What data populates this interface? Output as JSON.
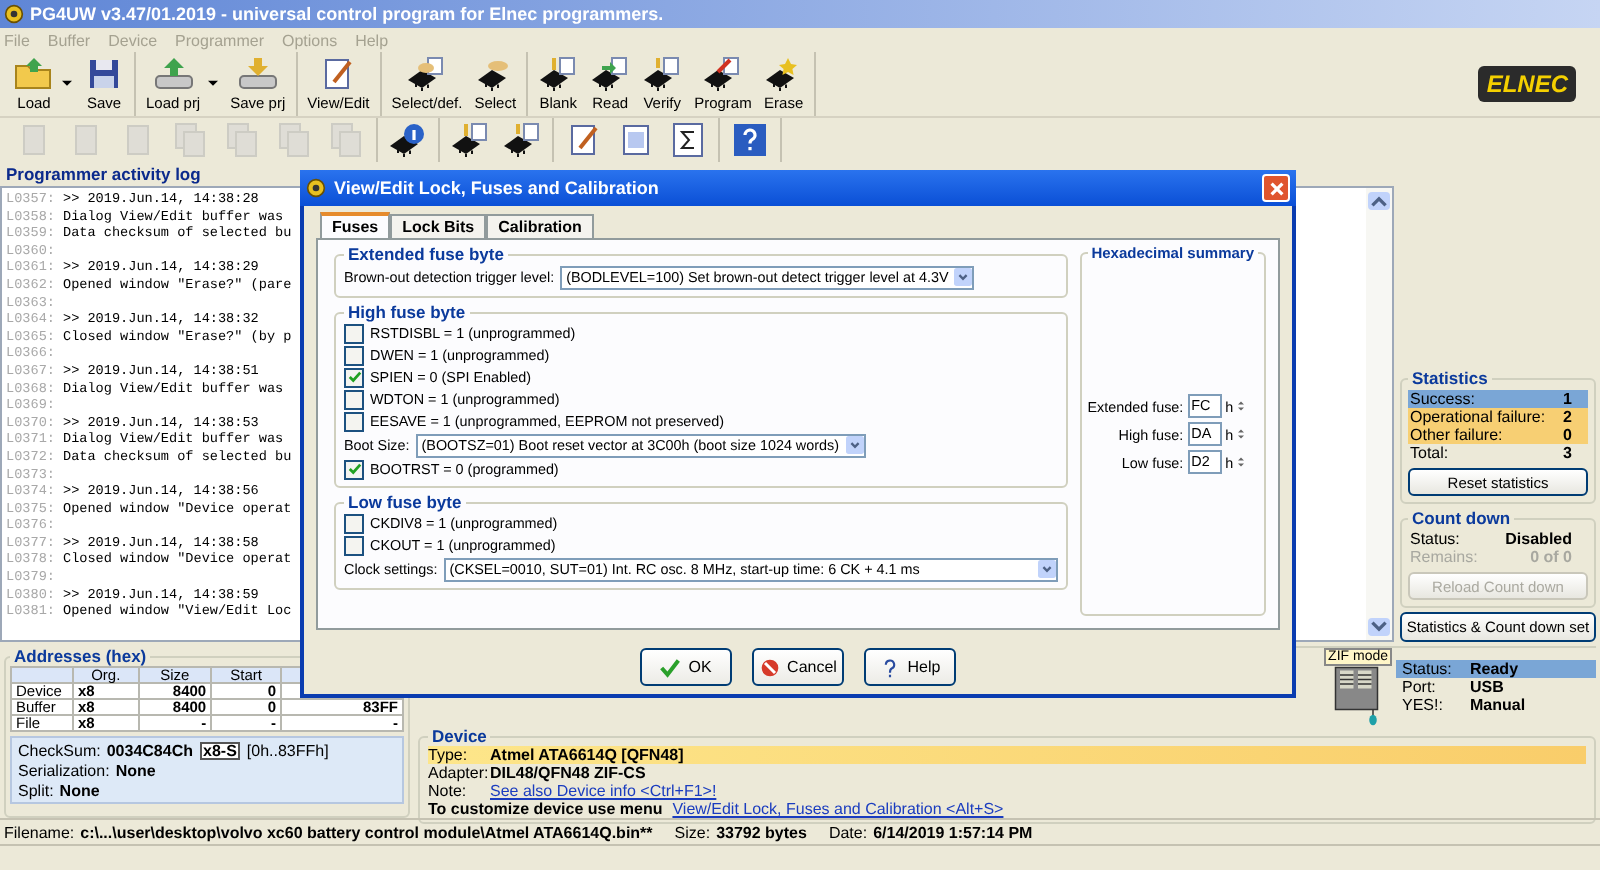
{
  "window": {
    "title": "PG4UW v3.47/01.2019 - universal control program for Elnec programmers."
  },
  "menu": [
    {
      "label": "File",
      "disabled": true
    },
    {
      "label": "Buffer",
      "disabled": true
    },
    {
      "label": "Device",
      "disabled": true
    },
    {
      "label": "Programmer",
      "disabled": true
    },
    {
      "label": "Options",
      "disabled": true
    },
    {
      "label": "Help",
      "disabled": true
    }
  ],
  "toolbar": {
    "groups": [
      {
        "buttons": [
          {
            "label": "Load",
            "kind": "folder",
            "dropdown": true
          },
          {
            "label": "Save",
            "kind": "disk",
            "dropdown": false
          }
        ]
      },
      {
        "buttons": [
          {
            "label": "Load prj",
            "kind": "drive-load",
            "dropdown": true
          },
          {
            "label": "Save prj",
            "kind": "drive-save",
            "dropdown": false
          }
        ]
      },
      {
        "buttons": [
          {
            "label": "View/Edit",
            "kind": "notepad",
            "dropdown": false
          }
        ]
      },
      {
        "buttons": [
          {
            "label": "Select/def.",
            "kind": "chip-select",
            "dropdown": false
          },
          {
            "label": "Select",
            "kind": "chip",
            "dropdown": false
          }
        ]
      },
      {
        "buttons": [
          {
            "label": "Blank",
            "kind": "chip-blank",
            "dropdown": false
          },
          {
            "label": "Read",
            "kind": "chip-read",
            "dropdown": false
          },
          {
            "label": "Verify",
            "kind": "chip-verify",
            "dropdown": false
          },
          {
            "label": "Program",
            "kind": "chip-program",
            "dropdown": false
          },
          {
            "label": "Erase",
            "kind": "chip-erase",
            "dropdown": false
          }
        ]
      }
    ]
  },
  "logo": "ELNEC",
  "toolbar_2": {
    "groups": [
      {
        "buttons": [
          {
            "kind": "page",
            "disabled": true
          },
          {
            "kind": "page",
            "disabled": true
          },
          {
            "kind": "page",
            "disabled": true
          },
          {
            "kind": "pages",
            "disabled": true
          },
          {
            "kind": "pages",
            "disabled": true
          },
          {
            "kind": "pages",
            "disabled": true
          },
          {
            "kind": "pages",
            "disabled": true
          }
        ]
      },
      {
        "buttons": [
          {
            "kind": "chip-info",
            "disabled": false
          }
        ]
      },
      {
        "buttons": [
          {
            "kind": "chip-blank",
            "disabled": false
          },
          {
            "kind": "chip-verify",
            "disabled": false
          }
        ]
      },
      {
        "buttons": [
          {
            "kind": "edit",
            "disabled": false
          },
          {
            "kind": "document",
            "disabled": false
          },
          {
            "kind": "sigma",
            "disabled": false
          }
        ]
      },
      {
        "buttons": [
          {
            "kind": "help",
            "disabled": false
          }
        ]
      }
    ]
  },
  "activity_log": {
    "title": "Programmer activity log",
    "lines": [
      {
        "number": "L0357:",
        "text": ">> 2019.Jun.14, 14:38:28"
      },
      {
        "number": "L0358:",
        "text": "Dialog View/Edit buffer was"
      },
      {
        "number": "L0359:",
        "text": "Data checksum of selected bu"
      },
      {
        "number": "L0360:"
      },
      {
        "number": "L0361:",
        "text": ">> 2019.Jun.14, 14:38:29"
      },
      {
        "number": "L0362:",
        "text": "Opened window \"Erase?\" (pare"
      },
      {
        "number": "L0363:"
      },
      {
        "number": "L0364:",
        "text": ">> 2019.Jun.14, 14:38:32"
      },
      {
        "number": "L0365:",
        "text": "Closed window \"Erase?\" (by p"
      },
      {
        "number": "L0366:"
      },
      {
        "number": "L0367:",
        "text": ">> 2019.Jun.14, 14:38:51"
      },
      {
        "number": "L0368:",
        "text": "Dialog View/Edit buffer was"
      },
      {
        "number": "L0369:"
      },
      {
        "number": "L0370:",
        "text": ">> 2019.Jun.14, 14:38:53"
      },
      {
        "number": "L0371:",
        "text": "Dialog View/Edit buffer was"
      },
      {
        "number": "L0372:",
        "text": "Data checksum of selected bu"
      },
      {
        "number": "L0373:"
      },
      {
        "number": "L0374:",
        "text": ">> 2019.Jun.14, 14:38:56"
      },
      {
        "number": "L0375:",
        "text": "Opened window \"Device operat"
      },
      {
        "number": "L0376:"
      },
      {
        "number": "L0377:",
        "text": ">> 2019.Jun.14, 14:38:58"
      },
      {
        "number": "L0378:",
        "text": "Closed window \"Device operat"
      },
      {
        "number": "L0379:"
      },
      {
        "number": "L0380:",
        "text": ">> 2019.Jun.14, 14:38:59"
      },
      {
        "number": "L0381:",
        "text": "Opened window \"View/Edit Loc"
      }
    ]
  },
  "statistics": {
    "title": "Statistics",
    "rows": [
      {
        "label": "Success:",
        "value": "1",
        "color": "#7aa6d6"
      },
      {
        "label": "Operational failure:",
        "value": "2",
        "color": "#f7cf73"
      },
      {
        "label": "Other failure:",
        "value": "0",
        "color": "#f7cf73"
      },
      {
        "label": "Total:",
        "value": "3"
      }
    ],
    "reset_button": "Reset statistics"
  },
  "count_down": {
    "title": "Count down",
    "rows": [
      {
        "label": "Status:",
        "value": "Disabled",
        "disabled": false
      },
      {
        "label": "Remains:",
        "value": "0 of 0",
        "disabled": true
      }
    ],
    "reload_button": {
      "label": "Reload Count down",
      "disabled": true
    }
  },
  "stats_button": "Statistics & Count down set",
  "addresses": {
    "title": "Addresses (hex)",
    "columns": [
      "Org.",
      "Size",
      "Start"
    ],
    "rows": [
      {
        "label": "Device",
        "cells": [
          "x8",
          "8400",
          "0"
        ]
      },
      {
        "label": "Buffer",
        "cells": [
          "x8",
          "8400",
          "0",
          "83FF"
        ]
      },
      {
        "label": "File",
        "cells": [
          "x8",
          "-",
          "-",
          "-"
        ]
      }
    ]
  },
  "checksum": {
    "label": "CheckSum:",
    "value": "0034C84Ch",
    "mode_button": "x8-S",
    "range": "[0h..83FFh]",
    "serialization_label": "Serialization:",
    "serialization": "None",
    "split_label": "Split:",
    "split": "None"
  },
  "programmer_status": {
    "zif_label": "ZIF mode",
    "rows": [
      {
        "label": "Status:",
        "value": "Ready",
        "highlighted": true
      },
      {
        "label": "Port:",
        "value": "USB",
        "highlighted": false
      },
      {
        "label": "YES!:",
        "value": "Manual",
        "highlighted": false
      }
    ]
  },
  "device": {
    "title": "Device",
    "rows": [
      {
        "label": "Type:",
        "value": "Atmel  ATA6614Q [QFN48]",
        "kind": "text",
        "highlighted": true
      },
      {
        "label": "Adapter:",
        "value": "DIL48/QFN48 ZIF-CS",
        "kind": "text",
        "highlighted": false
      },
      {
        "label": "Note:",
        "value": "See also Device info <Ctrl+F1>!",
        "kind": "link",
        "highlighted": false
      }
    ],
    "customize_text": "To customize device use menu",
    "customize_link": "View/Edit Lock, Fuses and Calibration <Alt+S>"
  },
  "status_bar": {
    "filename_label": "Filename:",
    "filename": "c:\\...\\user\\desktop\\volvo xc60 battery control module\\Atmel ATA6614Q.bin**",
    "size_label": "Size:",
    "size": "33792 bytes",
    "date_label": "Date:",
    "date": "6/14/2019 1:57:14 PM"
  },
  "dialog": {
    "title": "View/Edit Lock, Fuses and Calibration",
    "tabs": [
      {
        "label": "Fuses",
        "selected": true
      },
      {
        "label": "Lock Bits",
        "selected": false
      },
      {
        "label": "Calibration",
        "selected": false
      }
    ],
    "groups": [
      {
        "title": "Extended fuse byte",
        "items": [
          {
            "kind": "select",
            "label": "Brown-out detection trigger level:",
            "value": "(BODLEVEL=100) Set brown-out detect trigger level at 4.3V"
          }
        ]
      },
      {
        "title": "High fuse byte",
        "items": [
          {
            "kind": "checkbox",
            "label": "RSTDISBL = 1 (unprogrammed)",
            "checked": false
          },
          {
            "kind": "checkbox",
            "label": "DWEN = 1 (unprogrammed)",
            "checked": false
          },
          {
            "kind": "checkbox",
            "label": "SPIEN = 0 (SPI Enabled)",
            "checked": true
          },
          {
            "kind": "checkbox",
            "label": "WDTON = 1 (unprogrammed)",
            "checked": false
          },
          {
            "kind": "checkbox",
            "label": "EESAVE = 1 (unprogrammed, EEPROM not preserved)",
            "checked": false
          },
          {
            "kind": "select",
            "label": "Boot Size:",
            "value": "(BOOTSZ=01) Boot reset vector at 3C00h (boot size 1024 words)"
          },
          {
            "kind": "checkbox",
            "label": "BOOTRST = 0 (programmed)",
            "checked": true
          }
        ]
      },
      {
        "title": "Low fuse byte",
        "items": [
          {
            "kind": "checkbox",
            "label": "CKDIV8 = 1 (unprogrammed)",
            "checked": false
          },
          {
            "kind": "checkbox",
            "label": "CKOUT = 1 (unprogrammed)",
            "checked": false
          },
          {
            "kind": "select",
            "label": "Clock settings:",
            "value": "(CKSEL=0010, SUT=01) Int. RC osc. 8 MHz, start-up time: 6 CK + 4.1 ms"
          }
        ]
      }
    ],
    "hex_summary": {
      "title": "Hexadecimal summary",
      "rows": [
        {
          "label": "Extended fuse:",
          "value": "FC",
          "suffix": "h"
        },
        {
          "label": "High fuse:",
          "value": "DA",
          "suffix": "h"
        },
        {
          "label": "Low fuse:",
          "value": "D2",
          "suffix": "h"
        }
      ]
    },
    "buttons": [
      {
        "label": "OK",
        "kind": "ok"
      },
      {
        "label": "Cancel",
        "kind": "cancel"
      },
      {
        "label": "Help",
        "kind": "help"
      }
    ]
  }
}
